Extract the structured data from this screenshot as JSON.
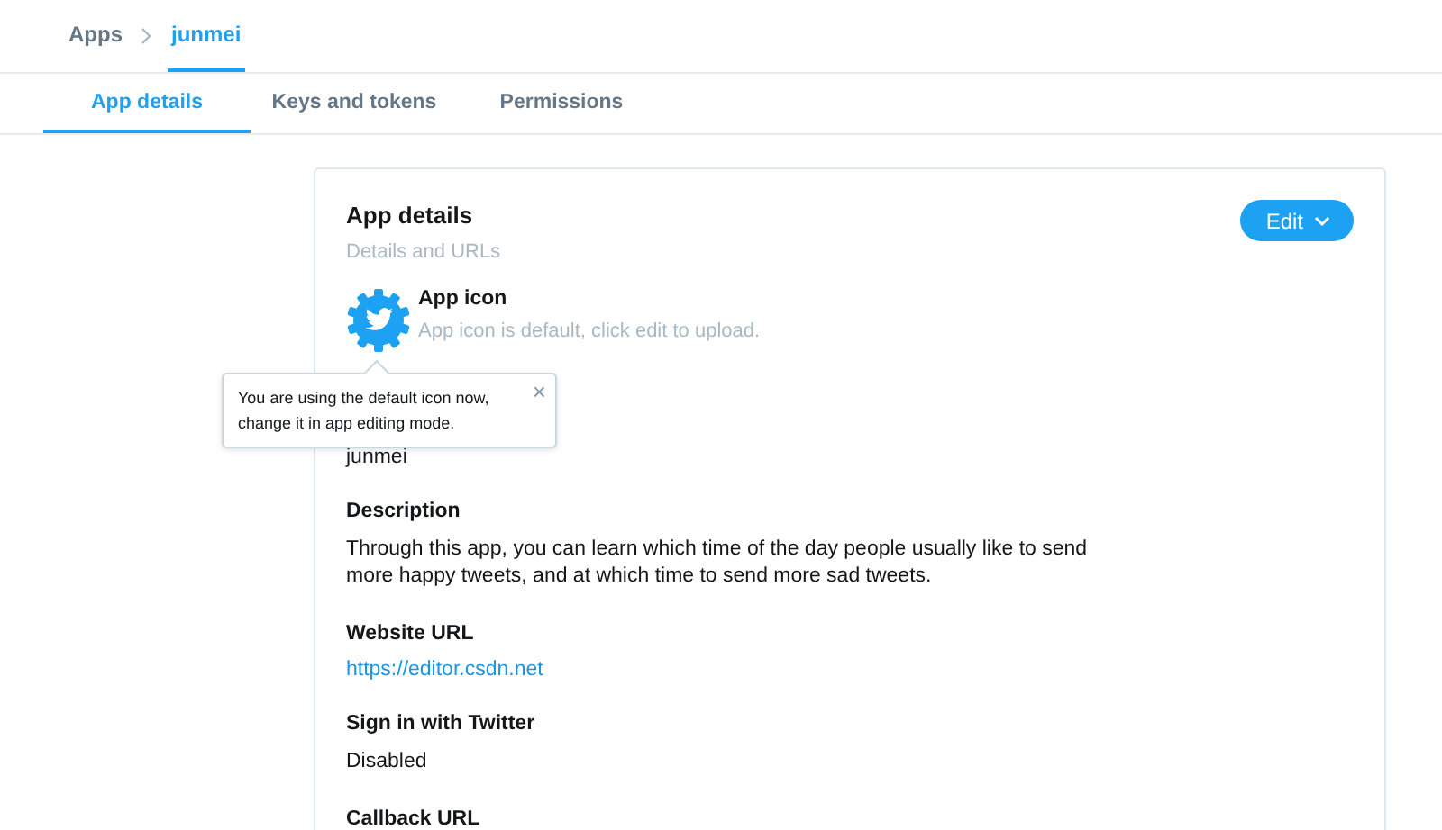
{
  "breadcrumb": [
    {
      "label": "Apps",
      "selected": false
    },
    {
      "label": "junmei",
      "selected": true
    }
  ],
  "tabs": [
    {
      "label": "App details",
      "selected": true
    },
    {
      "label": "Keys and tokens",
      "selected": false
    },
    {
      "label": "Permissions",
      "selected": false
    }
  ],
  "card": {
    "title": "App details",
    "subtitle": "Details and URLs",
    "edit_button": "Edit",
    "app_icon": {
      "label": "App icon",
      "hint": "App icon is default, click edit to upload."
    },
    "tooltip": {
      "text": "You are using the default icon now, change it in app editing mode.",
      "close": "×"
    },
    "app_name": "junmei",
    "fields": [
      {
        "label": "Description",
        "value": "Through this app, you can learn which time of the day people usually like to send more happy tweets, and at which time to send more sad tweets.",
        "kind": "text"
      },
      {
        "label": "Website URL",
        "value": "https://editor.csdn.net",
        "kind": "link"
      },
      {
        "label": "Sign in with Twitter",
        "value": "Disabled",
        "kind": "text"
      },
      {
        "label": "Callback URL"
      }
    ]
  }
}
